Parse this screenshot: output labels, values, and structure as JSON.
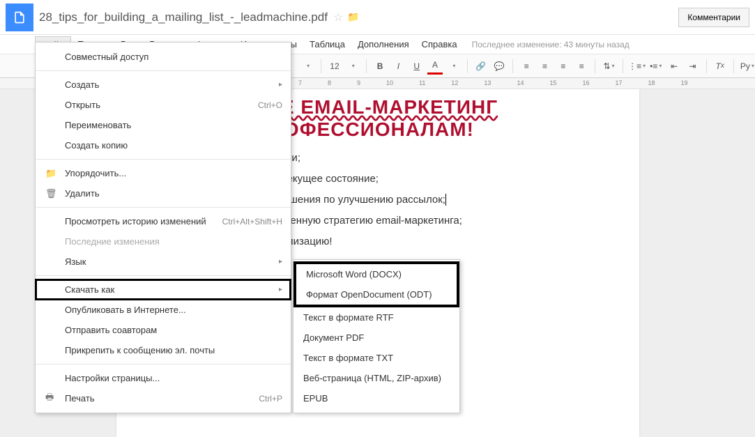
{
  "doc": {
    "title": "28_tips_for_building_a_mailing_list_-_leadmachine.pdf"
  },
  "header": {
    "comments": "Комментарии"
  },
  "menubar": {
    "items": [
      "Файл",
      "Правка",
      "Вид",
      "Вставка",
      "Формат",
      "Инструменты",
      "Таблица",
      "Дополнения",
      "Справка"
    ],
    "last_edit": "Последнее изменение: 43 минуты назад"
  },
  "toolbar": {
    "font_size": "12",
    "ru": "Ру"
  },
  "ruler": {
    "marks": [
      "7",
      "8",
      "9",
      "10",
      "11",
      "12",
      "13",
      "14",
      "15",
      "16",
      "17",
      "18",
      "19"
    ]
  },
  "content": {
    "h1_line1": "ЬТЕ EMAIL-МАРКЕТИНГ",
    "h1_line2": "ПРОФЕССИОНАЛАМ!",
    "lines": [
      "в задачи;",
      "руем текущее состояние;",
      "рые решения по улучшению рассылок;",
      "полноценную стратегию email-маркетинга;",
      "ва реализацию!"
    ]
  },
  "file_menu": {
    "share": "Совместный доступ",
    "new": "Создать",
    "open": "Открыть",
    "open_sc": "Ctrl+O",
    "rename": "Переименовать",
    "make_copy": "Создать копию",
    "organize": "Упорядочить...",
    "delete": "Удалить",
    "revision": "Просмотреть историю изменений",
    "revision_sc": "Ctrl+Alt+Shift+H",
    "recent": "Последние изменения",
    "language": "Язык",
    "download_as": "Скачать как",
    "publish": "Опубликовать в Интернете...",
    "email_collab": "Отправить соавторам",
    "email_attach": "Прикрепить к сообщению эл. почты",
    "page_setup": "Настройки страницы...",
    "print": "Печать",
    "print_sc": "Ctrl+P"
  },
  "submenu": {
    "docx": "Microsoft Word (DOCX)",
    "odt": "Формат OpenDocument (ODT)",
    "rtf": "Текст в формате RTF",
    "pdf": "Документ PDF",
    "txt": "Текст в формате TXT",
    "html": "Веб-страница (HTML, ZIP-архив)",
    "epub": "EPUB"
  }
}
